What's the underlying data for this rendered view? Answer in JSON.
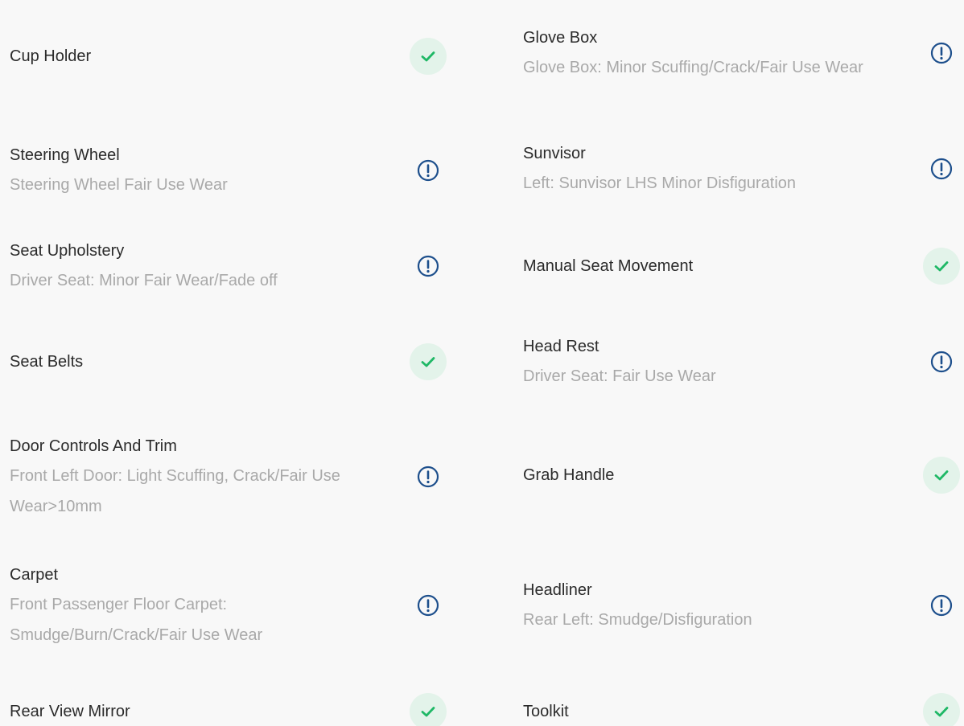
{
  "left": [
    {
      "title": "Cup Holder",
      "sub": "",
      "status": "ok"
    },
    {
      "title": "Steering Wheel",
      "sub": "Steering Wheel Fair Use Wear",
      "status": "warn"
    },
    {
      "title": "Seat Upholstery",
      "sub": "Driver Seat: Minor Fair Wear/Fade off",
      "status": "warn"
    },
    {
      "title": "Seat Belts",
      "sub": "",
      "status": "ok"
    },
    {
      "title": "Door Controls And Trim",
      "sub": "Front Left Door: Light Scuffing, Crack/Fair Use Wear>10mm",
      "status": "warn"
    },
    {
      "title": "Carpet",
      "sub": "Front Passenger Floor Carpet: Smudge/Burn/Crack/Fair Use Wear",
      "status": "warn"
    },
    {
      "title": "Rear View Mirror",
      "sub": "",
      "status": "ok"
    }
  ],
  "right": [
    {
      "title": "Glove Box",
      "sub": "Glove Box: Minor Scuffing/Crack/Fair Use Wear",
      "status": "warn"
    },
    {
      "title": "Sunvisor",
      "sub": "Left: Sunvisor LHS Minor Disfiguration",
      "status": "warn"
    },
    {
      "title": "Manual Seat Movement",
      "sub": "",
      "status": "ok"
    },
    {
      "title": "Head Rest",
      "sub": "Driver Seat: Fair Use Wear",
      "status": "warn"
    },
    {
      "title": "Grab Handle",
      "sub": "",
      "status": "ok"
    },
    {
      "title": "Headliner",
      "sub": "Rear Left: Smudge/Disfiguration",
      "status": "warn"
    },
    {
      "title": "Toolkit",
      "sub": "",
      "status": "ok"
    }
  ],
  "colors": {
    "ok_icon": "#1fb866",
    "ok_bg": "#e3f3ea",
    "warn_icon": "#1d4f8c"
  },
  "icons": {
    "ok": "check-icon",
    "warn": "exclamation-circle-icon"
  }
}
